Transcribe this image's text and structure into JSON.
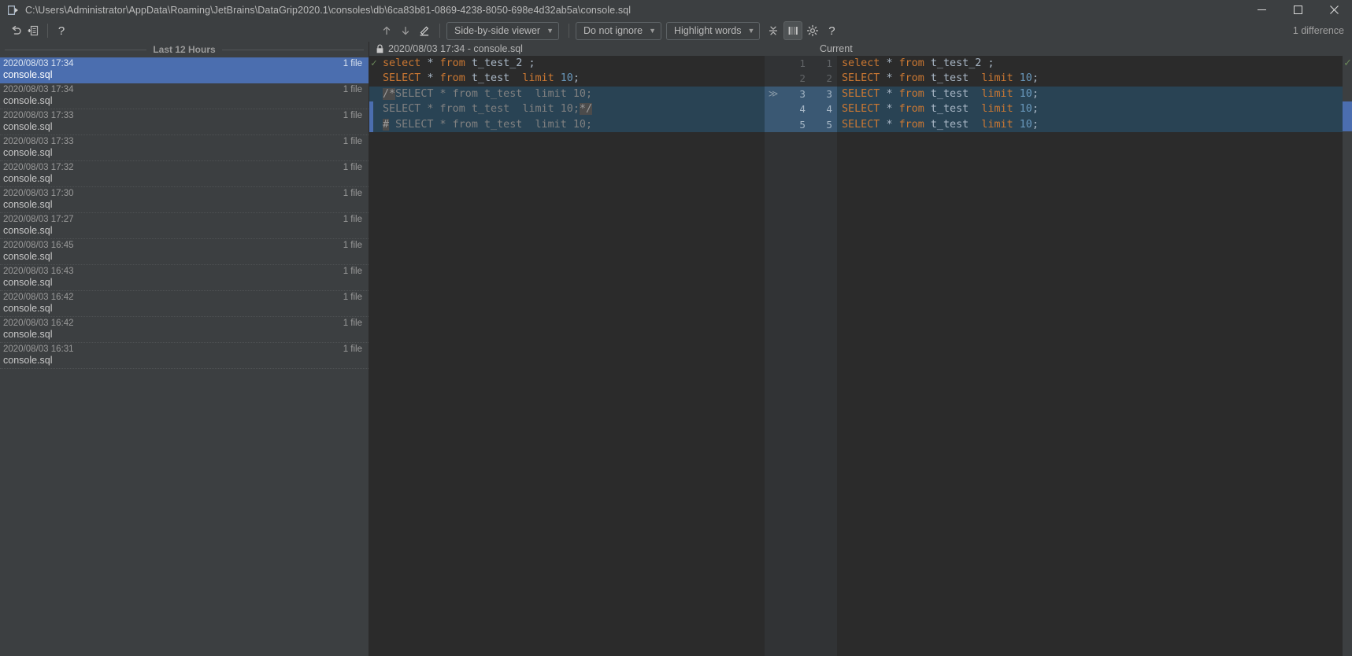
{
  "window": {
    "title": "C:\\Users\\Administrator\\AppData\\Roaming\\JetBrains\\DataGrip2020.1\\consoles\\db\\6ca83b81-0869-4238-8050-698e4d32ab5a\\console.sql",
    "app_icon": "datagrip-console-icon",
    "controls": {
      "minimize": "minimize-icon",
      "maximize": "maximize-icon",
      "close": "close-icon"
    }
  },
  "toolbar": {
    "left": {
      "revert_icon": "revert-icon",
      "revert_label": "Revert",
      "create_patch_icon": "create-patch-icon",
      "create_patch_label": "Create Patch",
      "help_icon": "help-icon",
      "help_label": "?"
    },
    "prev_diff_icon": "arrow-up-icon",
    "next_diff_icon": "arrow-down-icon",
    "edit_icon": "pencil-icon",
    "viewer_mode": "Side-by-side viewer",
    "ignore_policy": "Do not ignore",
    "highlight_mode": "Highlight words",
    "collapse_icon": "collapse-unchanged-icon",
    "whitespace_icon": "show-whitespace-icon",
    "settings_icon": "gear-icon",
    "help_icon": "question-mark-icon",
    "difference_count": "1 difference"
  },
  "sidebar": {
    "group_title": "Last 12 Hours",
    "items": [
      {
        "date": "2020/08/03 17:34",
        "file": "console.sql",
        "count": "1 file",
        "selected": true
      },
      {
        "date": "2020/08/03 17:34",
        "file": "console.sql",
        "count": "1 file",
        "selected": false
      },
      {
        "date": "2020/08/03 17:33",
        "file": "console.sql",
        "count": "1 file",
        "selected": false
      },
      {
        "date": "2020/08/03 17:33",
        "file": "console.sql",
        "count": "1 file",
        "selected": false
      },
      {
        "date": "2020/08/03 17:32",
        "file": "console.sql",
        "count": "1 file",
        "selected": false
      },
      {
        "date": "2020/08/03 17:30",
        "file": "console.sql",
        "count": "1 file",
        "selected": false
      },
      {
        "date": "2020/08/03 17:27",
        "file": "console.sql",
        "count": "1 file",
        "selected": false
      },
      {
        "date": "2020/08/03 16:45",
        "file": "console.sql",
        "count": "1 file",
        "selected": false
      },
      {
        "date": "2020/08/03 16:43",
        "file": "console.sql",
        "count": "1 file",
        "selected": false
      },
      {
        "date": "2020/08/03 16:42",
        "file": "console.sql",
        "count": "1 file",
        "selected": false
      },
      {
        "date": "2020/08/03 16:42",
        "file": "console.sql",
        "count": "1 file",
        "selected": false
      },
      {
        "date": "2020/08/03 16:31",
        "file": "console.sql",
        "count": "1 file",
        "selected": false
      }
    ]
  },
  "diff": {
    "left_title": "2020/08/03 17:34 - console.sql",
    "left_title_locked": true,
    "right_title": "Current",
    "left_lines": [
      {
        "changed": false,
        "status": "ok",
        "tokens": [
          {
            "t": "select",
            "c": "kw"
          },
          {
            "t": " ",
            "c": "id"
          },
          {
            "t": "*",
            "c": "punct"
          },
          {
            "t": " ",
            "c": "id"
          },
          {
            "t": "from",
            "c": "kw"
          },
          {
            "t": " ",
            "c": "id"
          },
          {
            "t": "t_test_2",
            "c": "id"
          },
          {
            "t": " ",
            "c": "id"
          },
          {
            "t": ";",
            "c": "punct"
          }
        ]
      },
      {
        "changed": false,
        "tokens": [
          {
            "t": "SELECT",
            "c": "kw"
          },
          {
            "t": " ",
            "c": "id"
          },
          {
            "t": "*",
            "c": "punct"
          },
          {
            "t": " ",
            "c": "id"
          },
          {
            "t": "from",
            "c": "kw"
          },
          {
            "t": " ",
            "c": "id"
          },
          {
            "t": "t_test",
            "c": "id"
          },
          {
            "t": "  ",
            "c": "id"
          },
          {
            "t": "limit",
            "c": "kw"
          },
          {
            "t": " ",
            "c": "id"
          },
          {
            "t": "10",
            "c": "num"
          },
          {
            "t": ";",
            "c": "punct"
          }
        ]
      },
      {
        "changed": true,
        "tokens": [
          {
            "t": "/*",
            "c": "cmt-hl"
          },
          {
            "t": "SELECT * from t_test  limit 10;",
            "c": "cmt"
          }
        ]
      },
      {
        "changed": true,
        "tokens": [
          {
            "t": "SELECT * from t_test  limit 10;",
            "c": "cmt"
          },
          {
            "t": "*/",
            "c": "cmt-hl"
          }
        ]
      },
      {
        "changed": true,
        "tokens": [
          {
            "t": "#",
            "c": "cmt-hl"
          },
          {
            "t": " SELECT * from t_test  limit 10;",
            "c": "cmt"
          }
        ]
      }
    ],
    "gutter_lines": [
      {
        "left_no": "1",
        "right_no": "1",
        "arrow": "",
        "changed": false
      },
      {
        "left_no": "2",
        "right_no": "2",
        "arrow": "",
        "changed": false
      },
      {
        "left_no": "3",
        "right_no": "3",
        "arrow": "≫",
        "changed": true
      },
      {
        "left_no": "4",
        "right_no": "4",
        "arrow": "",
        "changed": true
      },
      {
        "left_no": "5",
        "right_no": "5",
        "arrow": "",
        "changed": true
      }
    ],
    "right_lines": [
      {
        "changed": false,
        "tokens": [
          {
            "t": "select",
            "c": "kw"
          },
          {
            "t": " ",
            "c": "id"
          },
          {
            "t": "*",
            "c": "punct"
          },
          {
            "t": " ",
            "c": "id"
          },
          {
            "t": "from",
            "c": "kw"
          },
          {
            "t": " ",
            "c": "id"
          },
          {
            "t": "t_test_2",
            "c": "id"
          },
          {
            "t": " ",
            "c": "id"
          },
          {
            "t": ";",
            "c": "punct"
          }
        ]
      },
      {
        "changed": false,
        "tokens": [
          {
            "t": "SELECT",
            "c": "kw"
          },
          {
            "t": " ",
            "c": "id"
          },
          {
            "t": "*",
            "c": "punct"
          },
          {
            "t": " ",
            "c": "id"
          },
          {
            "t": "from",
            "c": "kw"
          },
          {
            "t": " ",
            "c": "id"
          },
          {
            "t": "t_test",
            "c": "id"
          },
          {
            "t": "  ",
            "c": "id"
          },
          {
            "t": "limit",
            "c": "kw"
          },
          {
            "t": " ",
            "c": "id"
          },
          {
            "t": "10",
            "c": "num"
          },
          {
            "t": ";",
            "c": "punct"
          }
        ]
      },
      {
        "changed": true,
        "tokens": [
          {
            "t": "SELECT",
            "c": "kw"
          },
          {
            "t": " ",
            "c": "id"
          },
          {
            "t": "*",
            "c": "punct"
          },
          {
            "t": " ",
            "c": "id"
          },
          {
            "t": "from",
            "c": "kw"
          },
          {
            "t": " ",
            "c": "id"
          },
          {
            "t": "t_test",
            "c": "id"
          },
          {
            "t": "  ",
            "c": "id"
          },
          {
            "t": "limit",
            "c": "kw"
          },
          {
            "t": " ",
            "c": "id"
          },
          {
            "t": "10",
            "c": "num"
          },
          {
            "t": ";",
            "c": "punct"
          }
        ]
      },
      {
        "changed": true,
        "tokens": [
          {
            "t": "SELECT",
            "c": "kw"
          },
          {
            "t": " ",
            "c": "id"
          },
          {
            "t": "*",
            "c": "punct"
          },
          {
            "t": " ",
            "c": "id"
          },
          {
            "t": "from",
            "c": "kw"
          },
          {
            "t": " ",
            "c": "id"
          },
          {
            "t": "t_test",
            "c": "id"
          },
          {
            "t": "  ",
            "c": "id"
          },
          {
            "t": "limit",
            "c": "kw"
          },
          {
            "t": " ",
            "c": "id"
          },
          {
            "t": "10",
            "c": "num"
          },
          {
            "t": ";",
            "c": "punct"
          }
        ]
      },
      {
        "changed": true,
        "tokens": [
          {
            "t": "SELECT",
            "c": "kw"
          },
          {
            "t": " ",
            "c": "id"
          },
          {
            "t": "*",
            "c": "punct"
          },
          {
            "t": " ",
            "c": "id"
          },
          {
            "t": "from",
            "c": "kw"
          },
          {
            "t": " ",
            "c": "id"
          },
          {
            "t": "t_test",
            "c": "id"
          },
          {
            "t": "  ",
            "c": "id"
          },
          {
            "t": "limit",
            "c": "kw"
          },
          {
            "t": " ",
            "c": "id"
          },
          {
            "t": "10",
            "c": "num"
          },
          {
            "t": ";",
            "c": "punct"
          }
        ]
      }
    ]
  },
  "colors": {
    "bg_chrome": "#3c3f41",
    "bg_editor": "#2b2b2b",
    "selection_blue": "#4b6eaf",
    "changed_line": "#294354",
    "keyword_orange": "#cc7832",
    "number_blue": "#6897bb",
    "identifier": "#a9b7c6",
    "comment_grey": "#808080",
    "ok_green": "#6a8759"
  }
}
